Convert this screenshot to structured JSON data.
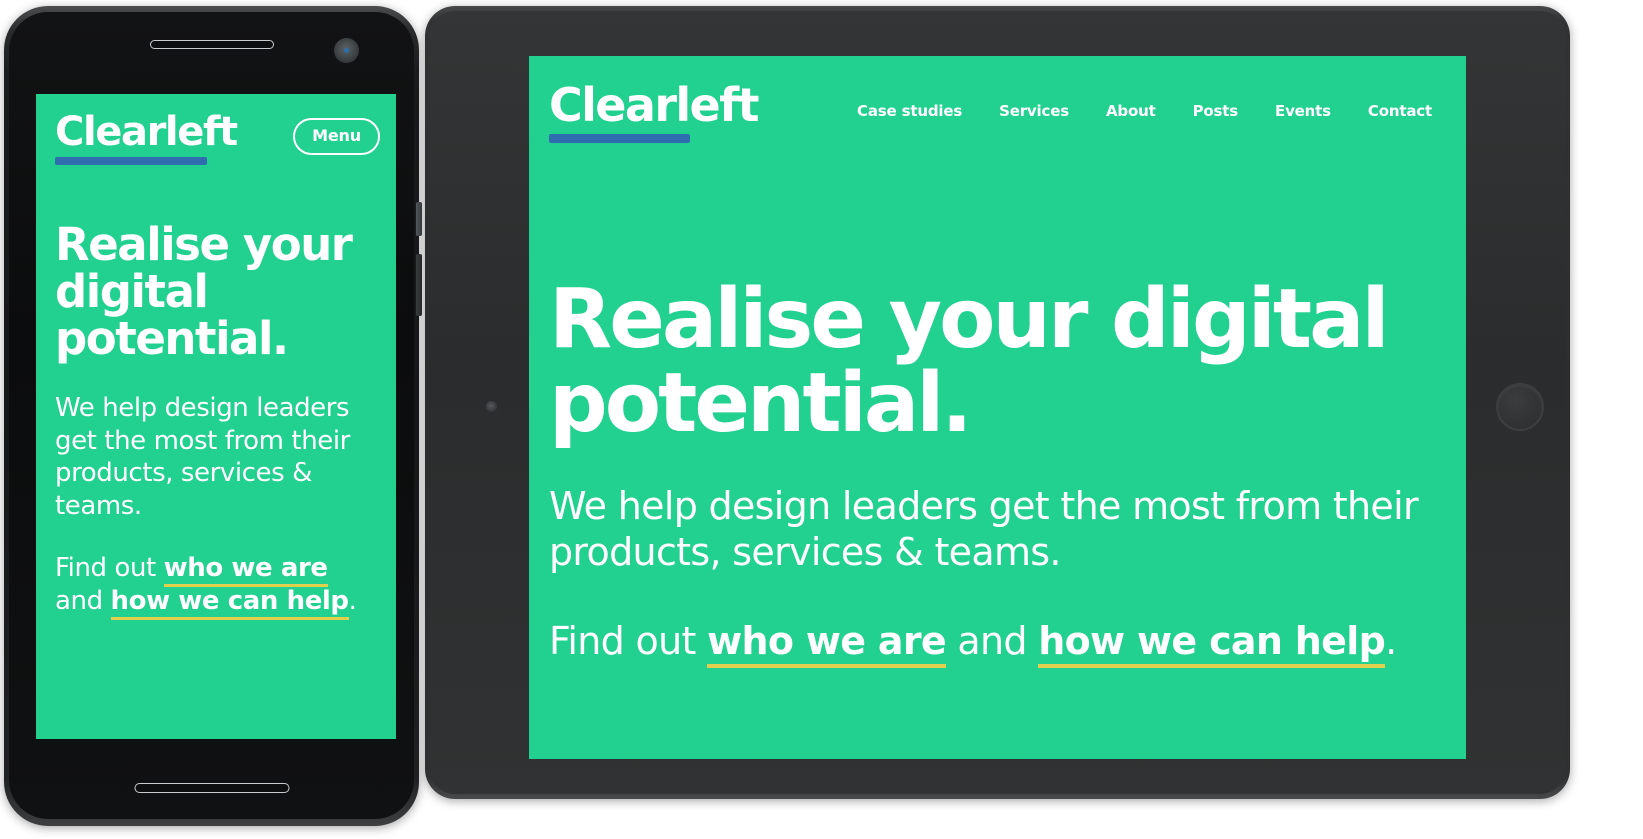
{
  "theme": {
    "brand_green": "#22d08f",
    "logo_underline_blue": "#2f6cb0",
    "link_underline_yellow": "#e3cf4e",
    "text_white": "#ffffff",
    "pattern_color": "#1fbe81",
    "device_body_dark": "#2c2e2f"
  },
  "site": {
    "brand": "Clearleft",
    "headline": "Realise your digital potential.",
    "body_copy": "We help design leaders get the most from their products, services & teams.",
    "cta": {
      "lead": "Find out ",
      "link_1": "who we are",
      "middle": " and ",
      "link_2": "how we can help",
      "end": "."
    }
  },
  "mobile": {
    "device": "phone",
    "menu_label": "Menu"
  },
  "tablet": {
    "device": "tablet",
    "nav_items": [
      {
        "label": "Case studies"
      },
      {
        "label": "Services"
      },
      {
        "label": "About"
      },
      {
        "label": "Posts"
      },
      {
        "label": "Events"
      },
      {
        "label": "Contact"
      }
    ]
  }
}
